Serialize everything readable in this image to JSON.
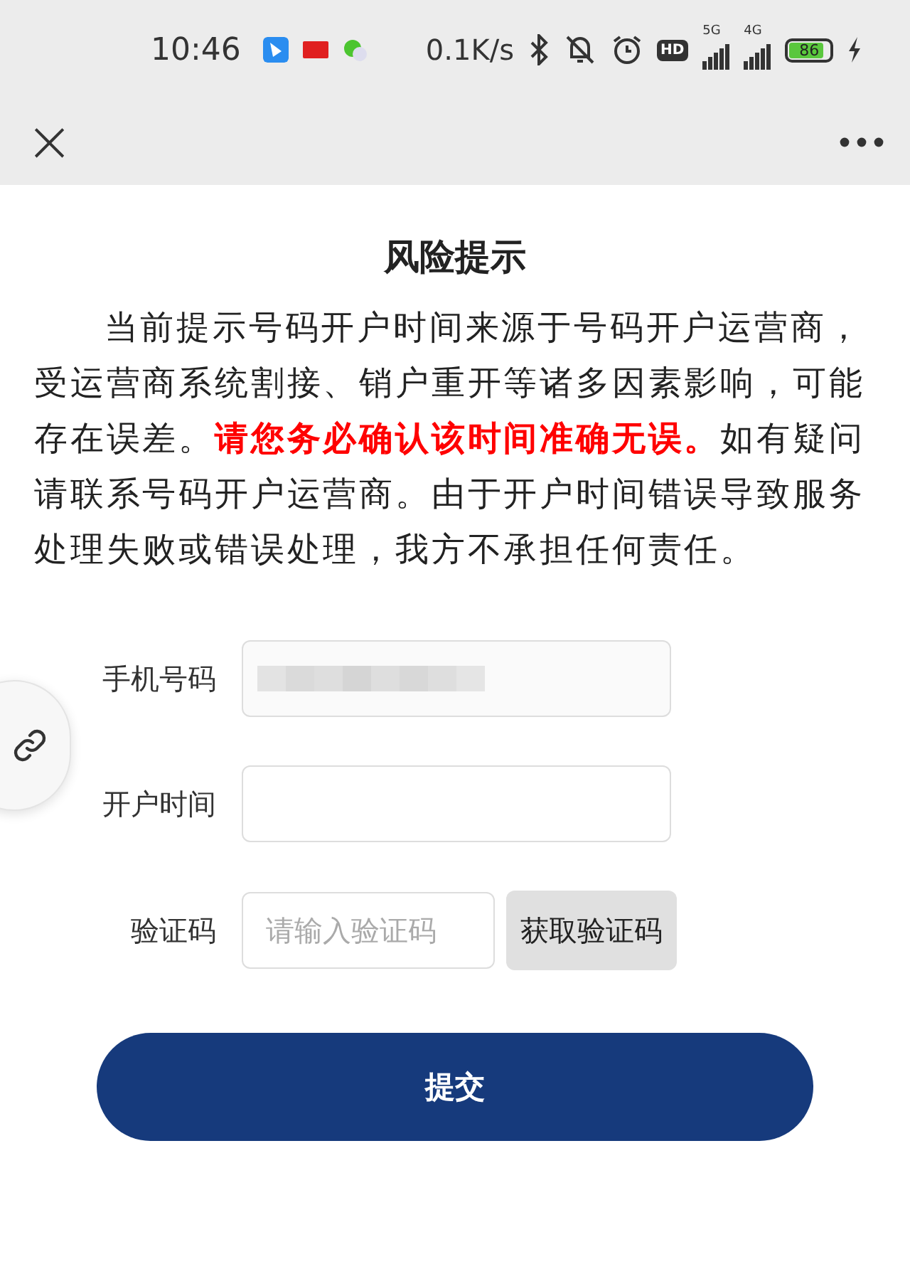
{
  "status_bar": {
    "time": "10:46",
    "speed": "0.1K/s",
    "hd": "HD",
    "sim1": "5G",
    "sim2": "4G",
    "battery": "86"
  },
  "top_bar": {
    "close": "×"
  },
  "title": "风险提示",
  "notice": "当前提示号码开户时间来源于号码开户运营商，受运营商系统割接、销户重开等诸多因素影响，可能存在误差。**请您务必确认该时间准确无误。**如有疑问请联系号码开户运营商。由于开户时间错误导致服务处理失败或错误处理，我方不承担任何责任。",
  "fields": [
    {
      "kind": "blurred",
      "label": "手机号码"
    },
    {
      "kind": "input",
      "label": "开户时间"
    },
    {
      "kind": "code",
      "label": "验证码",
      "placeholder": "请输入验证码",
      "button": "获取验证码"
    }
  ],
  "submit": "提交"
}
